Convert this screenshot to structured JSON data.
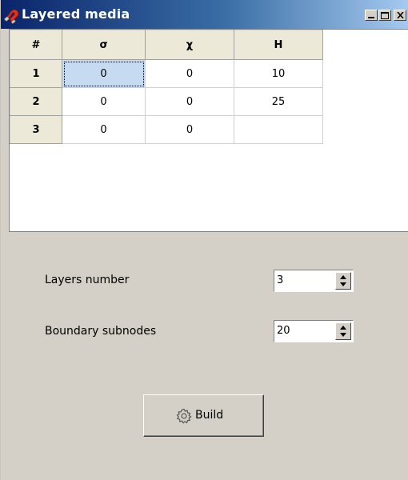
{
  "window": {
    "title": "Layered media",
    "icon": "magnet-icon"
  },
  "table": {
    "headers": [
      "#",
      "σ",
      "χ",
      "H"
    ],
    "rows": [
      {
        "num": "1",
        "sigma": "0",
        "chi": "0",
        "h": "10"
      },
      {
        "num": "2",
        "sigma": "0",
        "chi": "0",
        "h": "25"
      },
      {
        "num": "3",
        "sigma": "0",
        "chi": "0",
        "h": ""
      }
    ]
  },
  "form": {
    "layers_label": "Layers number",
    "layers_value": "3",
    "subnodes_label": "Boundary  subnodes",
    "subnodes_value": "20"
  },
  "build": {
    "label": "Build",
    "icon": "gear-icon"
  }
}
